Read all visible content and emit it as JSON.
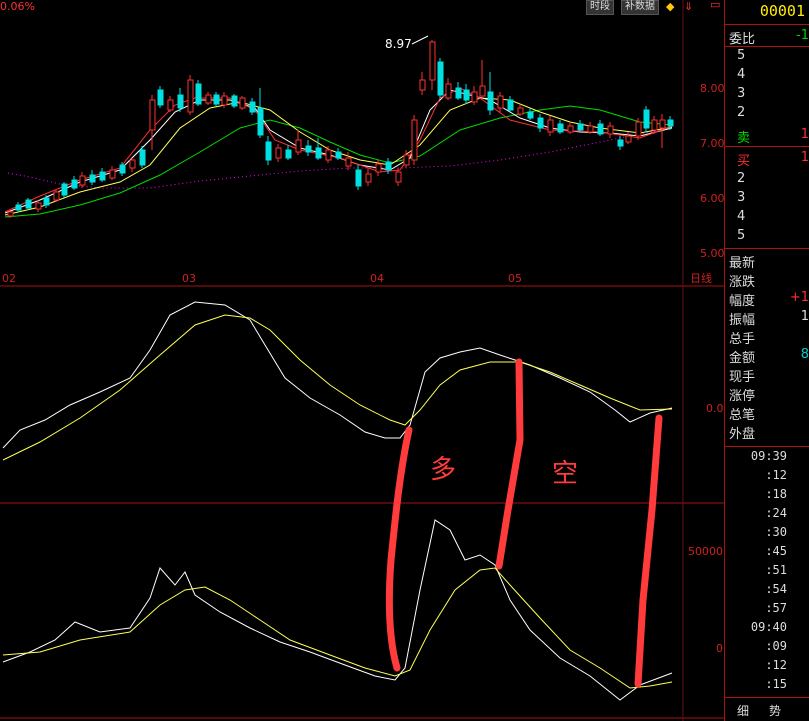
{
  "top": {
    "percent": "0.06%",
    "btn_time": "时段",
    "btn_data": "补数据"
  },
  "chart": {
    "price_labels": [
      "8.00",
      "7.00",
      "6.00",
      "5.00"
    ],
    "date_labels": [
      "02",
      "03",
      "04",
      "05"
    ],
    "period_label": "日线",
    "max_annotation": "8.97",
    "ind1_label": "0.0",
    "ind2_labels": [
      "50000",
      "0"
    ],
    "annot_long": "多",
    "annot_short": "空"
  },
  "panel": {
    "code": "00001",
    "weibi": {
      "label": "委比",
      "value": "-1"
    },
    "sell_levels": [
      "5",
      "4",
      "3",
      "2"
    ],
    "sell_label": "卖",
    "sell_value": "1",
    "buy_label": "买",
    "buy_value": "1",
    "buy_levels": [
      "2",
      "3",
      "4",
      "5"
    ],
    "stats": [
      {
        "label": "最新",
        "value": ""
      },
      {
        "label": "涨跌",
        "value": ""
      },
      {
        "label": "幅度",
        "value": "+1"
      },
      {
        "label": "振幅",
        "value": "1"
      },
      {
        "label": "总手",
        "value": ""
      },
      {
        "label": "金额",
        "value": "8"
      },
      {
        "label": "现手",
        "value": ""
      },
      {
        "label": "涨停",
        "value": ""
      },
      {
        "label": "总笔",
        "value": ""
      },
      {
        "label": "外盘",
        "value": ""
      }
    ],
    "ticks": [
      "09:39",
      ":12",
      ":18",
      ":24",
      ":30",
      ":45",
      ":51",
      ":54",
      ":57",
      "09:40",
      ":09",
      ":12",
      ":15"
    ],
    "tab_detail": "细",
    "tab_trend": "势"
  },
  "colors": {
    "up": "#ff3030",
    "down": "#00e0e0",
    "ma5": "#ffffff",
    "ma10": "#ffff55",
    "ma20": "#00dd00",
    "ma60": "#ff00ff",
    "annotation": "#ff3b3b"
  }
}
